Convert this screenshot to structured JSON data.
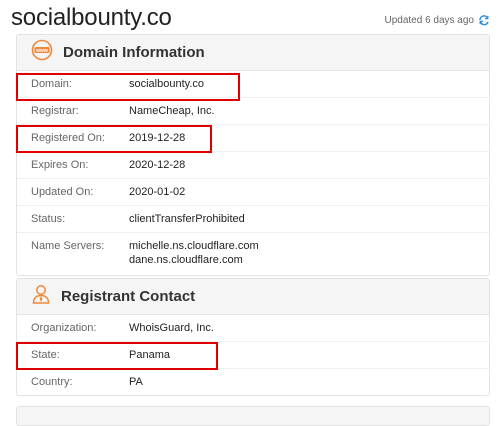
{
  "page": {
    "title": "socialbounty.co",
    "updated_text": "Updated 6 days ago"
  },
  "domain_info": {
    "title": "Domain Information",
    "icon": "www-icon",
    "rows": [
      {
        "label": "Domain:",
        "value": "socialbounty.co"
      },
      {
        "label": "Registrar:",
        "value": "NameCheap, Inc."
      },
      {
        "label": "Registered On:",
        "value": "2019-12-28"
      },
      {
        "label": "Expires On:",
        "value": "2020-12-28"
      },
      {
        "label": "Updated On:",
        "value": "2020-01-02"
      },
      {
        "label": "Status:",
        "value": "clientTransferProhibited"
      },
      {
        "label": "Name Servers:",
        "value": "michelle.ns.cloudflare.com",
        "value2": "dane.ns.cloudflare.com"
      }
    ]
  },
  "registrant": {
    "title": "Registrant Contact",
    "icon": "person-icon",
    "rows": [
      {
        "label": "Organization:",
        "value": "WhoisGuard, Inc."
      },
      {
        "label": "State:",
        "value": "Panama"
      },
      {
        "label": "Country:",
        "value": "PA"
      }
    ]
  },
  "colors": {
    "accent": "#f0883a",
    "highlight": "#e00000",
    "refresh": "#2a8fd8"
  }
}
